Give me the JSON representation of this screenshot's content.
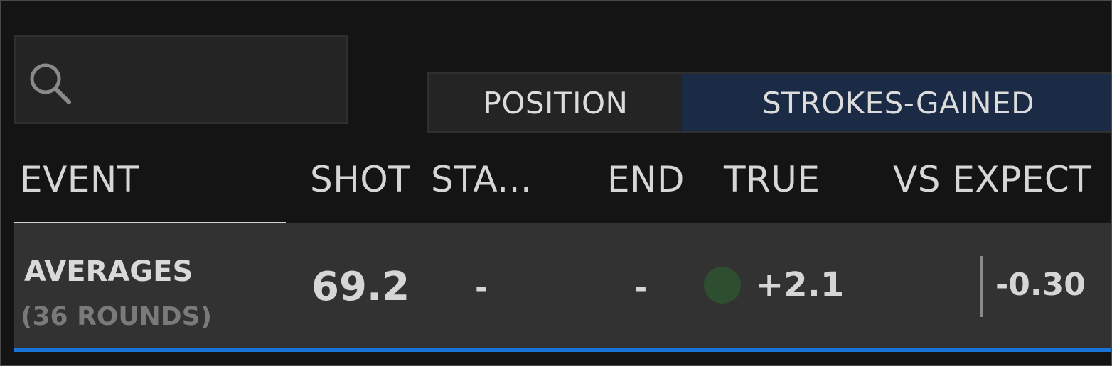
{
  "search": {
    "placeholder": "",
    "icon": "search-icon"
  },
  "toggle": {
    "options": [
      {
        "label": "POSITION",
        "active": false
      },
      {
        "label": "STROKES-GAINED",
        "active": true
      }
    ],
    "active_color": "#1b2a45"
  },
  "columns": {
    "event": "EVENT",
    "shot": "SHOT",
    "start": "STA...",
    "end": "END",
    "true": "TRUE",
    "vs_expect": "VS EXPECT"
  },
  "averages_row": {
    "label": "AVERAGES",
    "sublabel": "(36 ROUNDS)",
    "shot": "69.2",
    "start": "-",
    "end": "-",
    "true_value": "+2.1",
    "true_indicator_color": "#2d4f2f",
    "vs_expect": "-0.30"
  },
  "colors": {
    "background": "#141414",
    "row_background": "#323232",
    "accent": "#1a73d9"
  }
}
